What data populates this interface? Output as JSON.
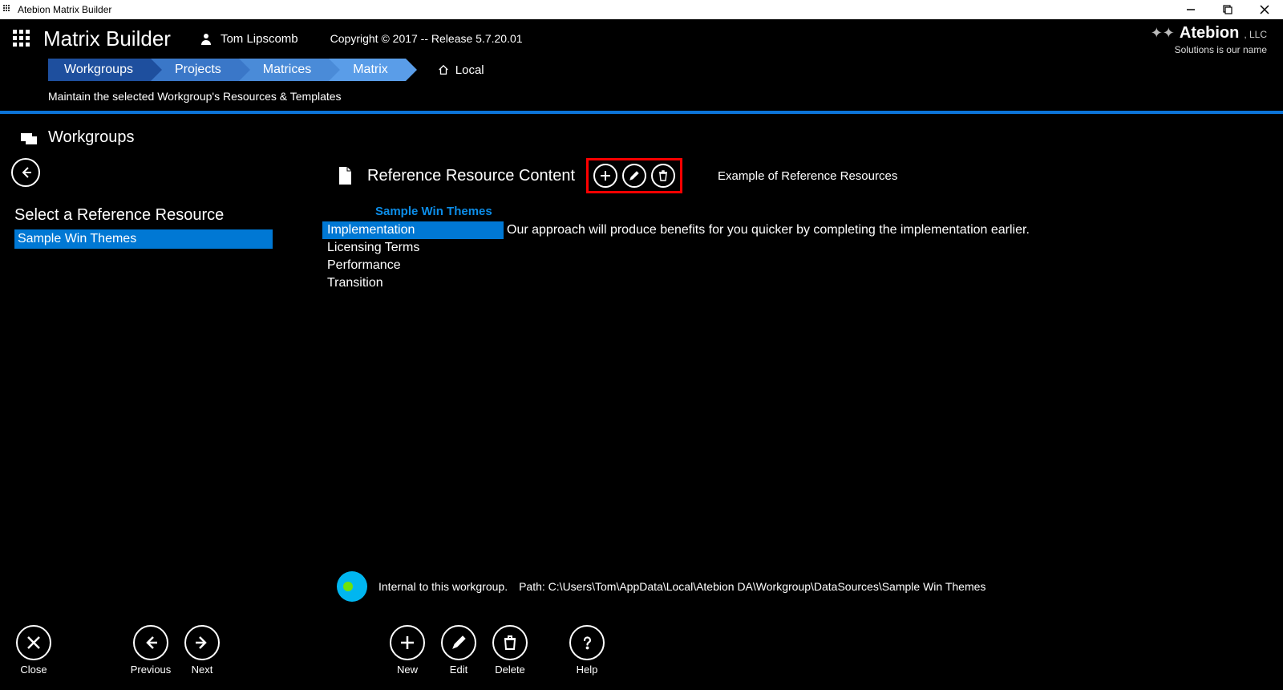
{
  "window": {
    "title": "Atebion Matrix Builder"
  },
  "header": {
    "app_title": "Matrix Builder",
    "user_name": "Tom Lipscomb",
    "copyright": "Copyright © 2017 -- Release 5.7.20.01",
    "brand_name": "Atebion",
    "brand_suffix": ", LLC",
    "tagline": "Solutions is our name"
  },
  "breadcrumb": {
    "items": [
      "Workgroups",
      "Projects",
      "Matrices",
      "Matrix"
    ],
    "location_label": "Local",
    "subtext": "Maintain the selected Workgroup's Resources & Templates"
  },
  "section": {
    "title": "Workgroups"
  },
  "left": {
    "title": "Select a Reference Resource",
    "items": [
      "Sample Win Themes"
    ],
    "selected_index": 0
  },
  "content": {
    "title": "Reference Resource Content",
    "example_label": "Example of Reference Resources",
    "group_name": "Sample Win Themes",
    "items": [
      "Implementation",
      "Licensing Terms",
      "Performance",
      "Transition"
    ],
    "selected_index": 0,
    "description": "Our approach will produce benefits for you quicker by completing the implementation earlier."
  },
  "status": {
    "scope": "Internal to this workgroup.",
    "path_label": "Path: C:\\Users\\Tom\\AppData\\Local\\Atebion DA\\Workgroup\\DataSources\\Sample Win Themes"
  },
  "bottom": {
    "close": "Close",
    "previous": "Previous",
    "next": "Next",
    "new": "New",
    "edit": "Edit",
    "delete": "Delete",
    "help": "Help"
  }
}
